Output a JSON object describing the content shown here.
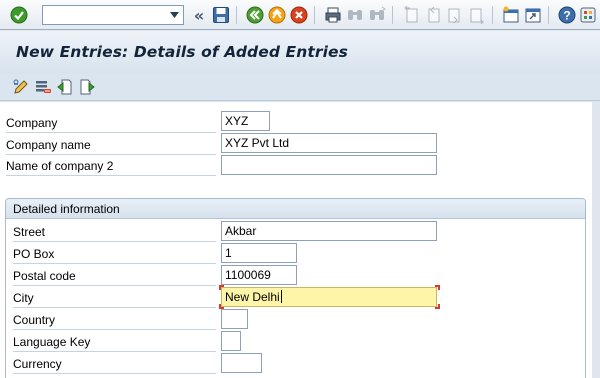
{
  "toolbar": {
    "command_field_value": "",
    "back_glyph": "«",
    "icons": [
      "enter-icon",
      "save-icon",
      "back-icon",
      "exit-icon",
      "cancel-icon",
      "print-icon",
      "find-icon",
      "find-next-icon",
      "first-page-icon",
      "previous-page-icon",
      "next-page-icon",
      "last-page-icon",
      "create-session-icon",
      "shortcut-icon",
      "help-icon",
      "customize-layout-icon"
    ]
  },
  "page": {
    "title": "New Entries: Details of Added Entries"
  },
  "app_toolbar": {
    "icons": [
      "change-display-icon",
      "delete-icon",
      "previous-entry-icon",
      "next-entry-icon"
    ]
  },
  "form": {
    "company": {
      "label": "Company",
      "value": "XYZ"
    },
    "company_name": {
      "label": "Company name",
      "value": "XYZ Pvt Ltd"
    },
    "name_of_company_2": {
      "label": "Name of company 2",
      "value": ""
    },
    "detailed_information": {
      "title": "Detailed information",
      "street": {
        "label": "Street",
        "value": "Akbar"
      },
      "po_box": {
        "label": "PO Box",
        "value": "1"
      },
      "postal_code": {
        "label": "Postal code",
        "value": "1100069"
      },
      "city": {
        "label": "City",
        "value": "New Delhi"
      },
      "country": {
        "label": "Country",
        "value": ""
      },
      "language_key": {
        "label": "Language Key",
        "value": ""
      },
      "currency": {
        "label": "Currency",
        "value": ""
      }
    }
  },
  "colors": {
    "active_field": "#fff5a8",
    "title_text": "#14243a",
    "group_header": "#d5e1ed"
  }
}
